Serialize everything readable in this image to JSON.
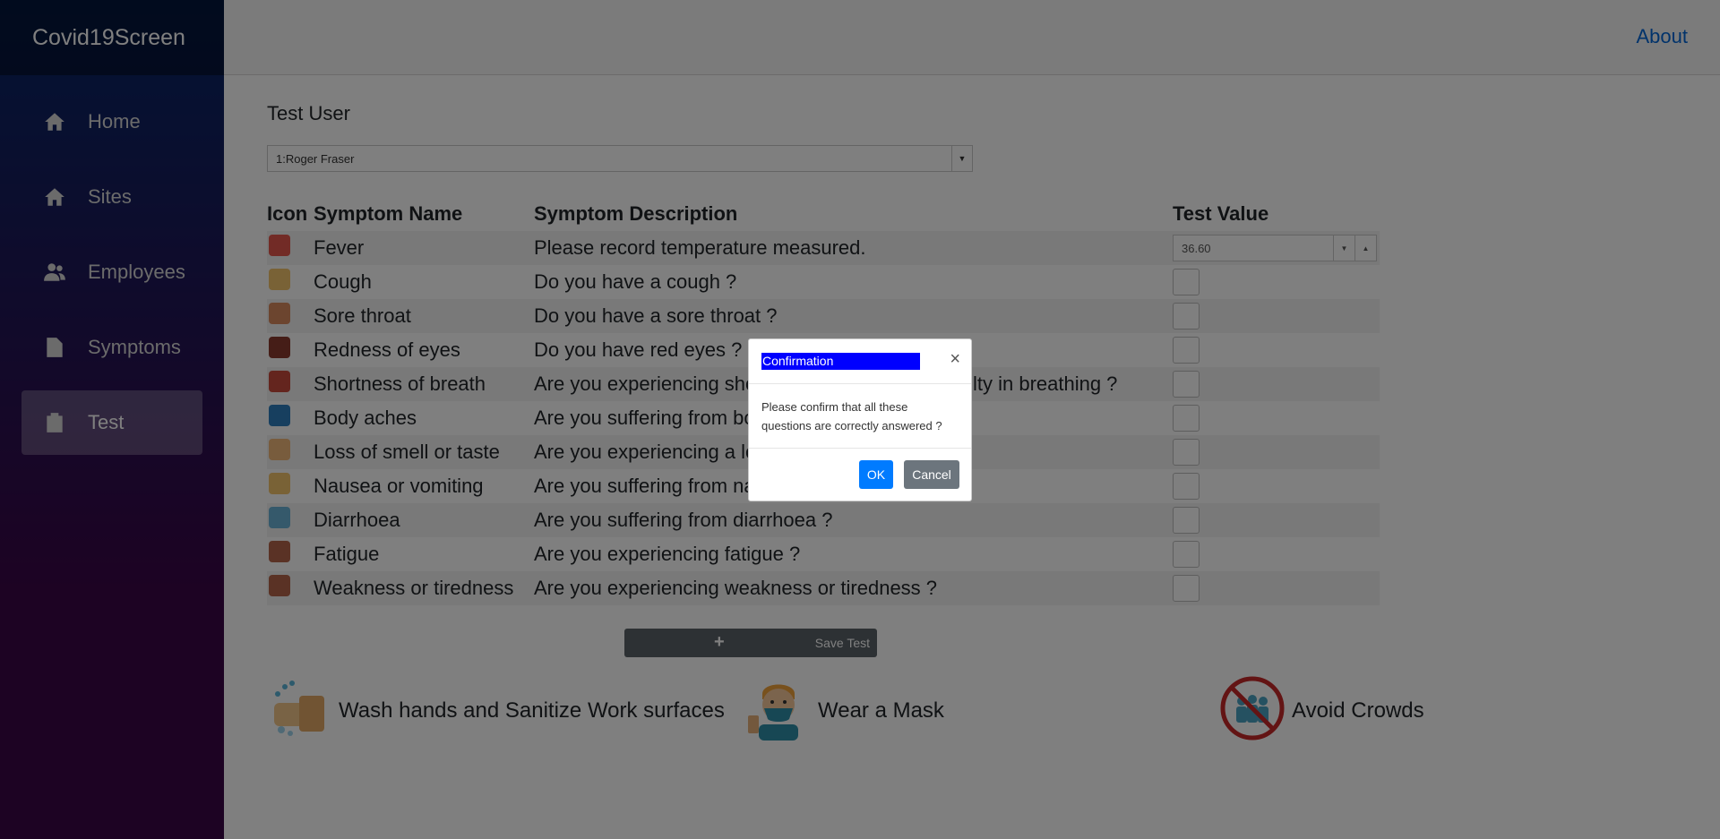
{
  "app": {
    "brand": "Covid19Screen",
    "about_link": "About"
  },
  "sidebar": {
    "items": [
      {
        "label": "Home",
        "icon": "home-icon",
        "active": false
      },
      {
        "label": "Sites",
        "icon": "home-icon",
        "active": false
      },
      {
        "label": "Employees",
        "icon": "users-icon",
        "active": false
      },
      {
        "label": "Symptoms",
        "icon": "document-icon",
        "active": false
      },
      {
        "label": "Test",
        "icon": "clipboard-icon",
        "active": true
      }
    ]
  },
  "test_form": {
    "user_label": "Test User",
    "selected_user": "1:Roger Fraser",
    "table": {
      "headers": [
        "Icon",
        "Symptom Name",
        "Symptom Description",
        "Test Value"
      ],
      "rows": [
        {
          "name": "Fever",
          "description": "Please record temperature measured.",
          "value_type": "numeric",
          "value": "36.60",
          "icon_color": "#e4574c"
        },
        {
          "name": "Cough",
          "description": "Do you have a cough ?",
          "value_type": "checkbox",
          "icon_color": "#f2c46d"
        },
        {
          "name": "Sore throat",
          "description": "Do you have a sore throat ?",
          "value_type": "checkbox",
          "icon_color": "#d98b5f"
        },
        {
          "name": "Redness of eyes",
          "description": "Do you have red eyes ?",
          "value_type": "checkbox",
          "icon_color": "#8a3a2e"
        },
        {
          "name": "Shortness of breath",
          "description": "Are you experiencing shortness of breath or difficulty in breathing ?",
          "value_type": "checkbox",
          "icon_color": "#c84b3c"
        },
        {
          "name": "Body aches",
          "description": "Are you suffering from body aches ?",
          "value_type": "checkbox",
          "icon_color": "#2f7fbf"
        },
        {
          "name": "Loss of smell or taste",
          "description": "Are you experiencing a loss of smell or taste ?",
          "value_type": "checkbox",
          "icon_color": "#f0b97a"
        },
        {
          "name": "Nausea or vomiting",
          "description": "Are you suffering from nausea or vomiting ?",
          "value_type": "checkbox",
          "icon_color": "#f2c46d"
        },
        {
          "name": "Diarrhoea",
          "description": "Are you suffering from diarrhoea ?",
          "value_type": "checkbox",
          "icon_color": "#6bb3d6"
        },
        {
          "name": "Fatigue",
          "description": "Are you experiencing fatigue ?",
          "value_type": "checkbox",
          "icon_color": "#b5654a"
        },
        {
          "name": "Weakness or tiredness",
          "description": "Are you experiencing weakness or tiredness ?",
          "value_type": "checkbox",
          "icon_color": "#b5654a"
        }
      ]
    },
    "save_button": "Save Test"
  },
  "tips": [
    {
      "label": "Wash hands and Sanitize Work surfaces",
      "icon": "wash-hands-icon"
    },
    {
      "label": "Wear a Mask",
      "icon": "mask-icon"
    },
    {
      "label": "Avoid Crowds",
      "icon": "no-crowds-icon"
    }
  ],
  "modal": {
    "title": "Confirmation",
    "close_glyph": "×",
    "message_line1": "Please confirm that all these",
    "message_line2": "questions are correctly answered ?",
    "ok_label": "OK",
    "cancel_label": "Cancel"
  },
  "colors": {
    "sidebar_top": "#052767",
    "sidebar_bottom": "#3a0647",
    "accent_blue": "#007bff",
    "link_blue": "#0366d6",
    "title_highlight": "#0000ff"
  }
}
